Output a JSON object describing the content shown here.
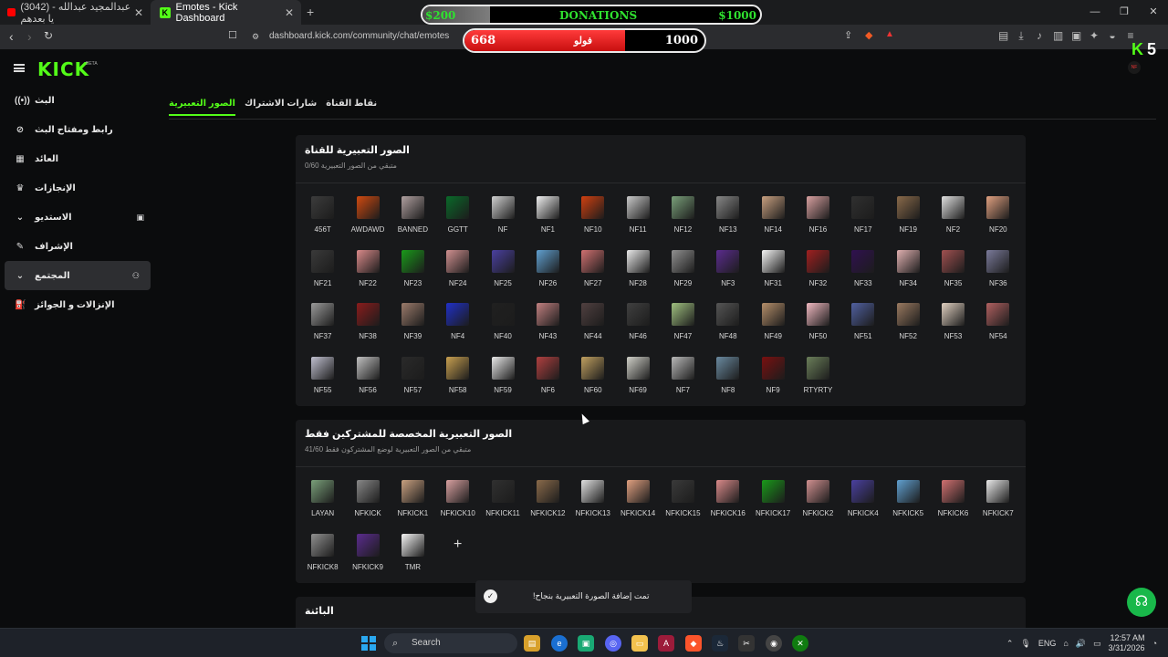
{
  "browser": {
    "tabs": [
      {
        "title": "(3042) عبدالمجيد عبدالله - يا بعدهم",
        "icon": "youtube-icon"
      },
      {
        "title": "Emotes - Kick Dashboard",
        "icon": "kick-icon"
      }
    ],
    "url": "dashboard.kick.com/community/chat/emotes"
  },
  "overlays": {
    "donations": {
      "label": "DONATIONS",
      "current": "$200",
      "goal": "$1000",
      "progress": 0.2
    },
    "followers": {
      "label": "فولو",
      "current": "668",
      "goal": "1000",
      "progress": 0.668
    }
  },
  "brand": {
    "logo": "KICK",
    "badge": "BETA",
    "corner": "5",
    "accent": "#53fc18"
  },
  "sidebar": {
    "items": [
      {
        "label": "البث",
        "icon": "live-icon"
      },
      {
        "label": "رابط ومفتاح البث",
        "icon": "link-icon"
      },
      {
        "label": "العائد",
        "icon": "chart-icon"
      },
      {
        "label": "الإنجازات",
        "icon": "trophy-icon"
      },
      {
        "label": "الاستديو",
        "icon": "chevron-down-icon"
      },
      {
        "label": "الإشراف",
        "icon": "wrench-icon"
      },
      {
        "label": "المجتمع",
        "icon": "chevron-down-icon"
      },
      {
        "label": "الإنزالات و الجوائز",
        "icon": "drops-icon"
      }
    ]
  },
  "tabs": [
    {
      "label": "الصور التعبيرية",
      "active": true
    },
    {
      "label": "شارات الاشتراك",
      "active": false
    },
    {
      "label": "نقاط القناة",
      "active": false
    }
  ],
  "channel_emotes": {
    "title": "الصور التعبيرية للقناة",
    "subtitle": "0/60 متبقي من الصور التعبيرية",
    "items": [
      "456T",
      "AWDAWD",
      "BANNED",
      "GGTT",
      "NF",
      "NF1",
      "NF10",
      "NF11",
      "NF12",
      "NF13",
      "NF14",
      "NF16",
      "NF17",
      "NF19",
      "NF2",
      "NF20",
      "NF21",
      "NF22",
      "NF23",
      "NF24",
      "NF25",
      "NF26",
      "NF27",
      "NF28",
      "NF29",
      "NF3",
      "NF31",
      "NF32",
      "NF33",
      "NF34",
      "NF35",
      "NF36",
      "NF37",
      "NF38",
      "NF39",
      "NF4",
      "NF40",
      "NF43",
      "NF44",
      "NF46",
      "NF47",
      "NF48",
      "NF49",
      "NF50",
      "NF51",
      "NF52",
      "NF53",
      "NF54",
      "NF55",
      "NF56",
      "NF57",
      "NF58",
      "NF59",
      "NF6",
      "NF60",
      "NF69",
      "NF7",
      "NF8",
      "NF9",
      "RTYRTY"
    ]
  },
  "subscriber_emotes": {
    "title": "الصور التعبيرية المخصصة للمشتركين فقط",
    "subtitle": "41/60 متبقي من الصور التعبيرية لوضع المشتركون فقط",
    "items": [
      "LAYAN",
      "NFKICK",
      "NFKICK1",
      "NFKICK10",
      "NFKICK11",
      "NFKICK12",
      "NFKICK13",
      "NFKICK14",
      "NFKICK15",
      "NFKICK16",
      "NFKICK17",
      "NFKICK2",
      "NFKICK4",
      "NFKICK5",
      "NFKICK6",
      "NFKICK7",
      "NFKICK8",
      "NFKICK9",
      "TMR"
    ],
    "add_label": "+"
  },
  "third_section": {
    "title": "البائنة"
  },
  "toast": {
    "message": "!تمت إضافة الصورة التعبيرية بنجاح"
  },
  "taskbar": {
    "search_placeholder": "Search",
    "lang": "ENG",
    "time": "12:57 AM",
    "date": "3/31/2026"
  }
}
